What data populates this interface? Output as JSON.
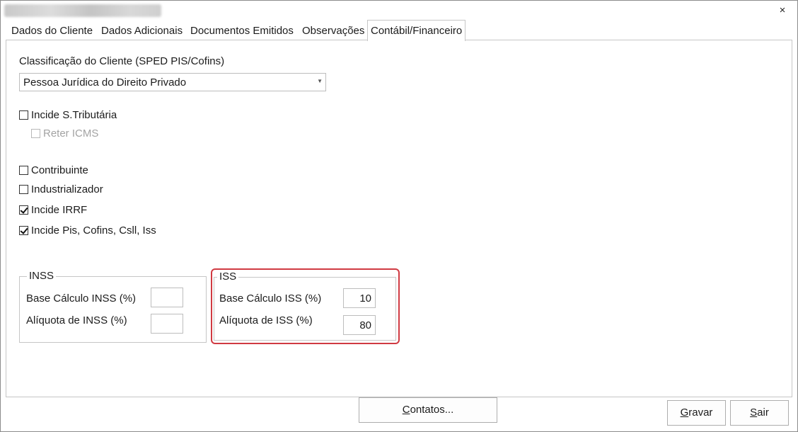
{
  "window": {
    "close_icon": "×"
  },
  "tabs": [
    {
      "label": "Dados do Cliente",
      "active": false
    },
    {
      "label": "Dados Adicionais",
      "active": false
    },
    {
      "label": "Documentos Emitidos",
      "active": false
    },
    {
      "label": "Observações",
      "active": false
    },
    {
      "label": "Contábil/Financeiro",
      "active": true
    }
  ],
  "classificacao": {
    "label": "Classificação do Cliente (SPED PIS/Cofins)",
    "selected": "Pessoa Jurídica do Direito Privado"
  },
  "checkboxes": {
    "incide_st": {
      "label": "Incide S.Tributária",
      "checked": false
    },
    "reter_icms": {
      "label": "Reter ICMS",
      "checked": false,
      "disabled": true
    },
    "contribuinte": {
      "label": "Contribuinte",
      "checked": false
    },
    "industrializador": {
      "label": "Industrializador",
      "checked": false
    },
    "incide_irrf": {
      "label": "Incide IRRF",
      "checked": true
    },
    "incide_pis": {
      "label": "Incide Pis, Cofins, Csll, Iss",
      "checked": true
    }
  },
  "inss": {
    "legend": "INSS",
    "base_label": "Base Cálculo INSS (%)",
    "base_value": "",
    "aliquota_label": "Alíquota de INSS (%)",
    "aliquota_value": ""
  },
  "iss": {
    "legend": "ISS",
    "base_label": "Base Cálculo ISS (%)",
    "base_value": "10",
    "aliquota_label": "Alíquota de ISS (%)",
    "aliquota_value": "80"
  },
  "buttons": {
    "contatos": {
      "mnemonic": "C",
      "rest": "ontatos..."
    },
    "gravar": {
      "mnemonic": "G",
      "rest": "ravar"
    },
    "sair": {
      "mnemonic": "S",
      "rest": "air"
    }
  },
  "colors": {
    "highlight": "#d03a42",
    "border": "#c6c6c6"
  }
}
